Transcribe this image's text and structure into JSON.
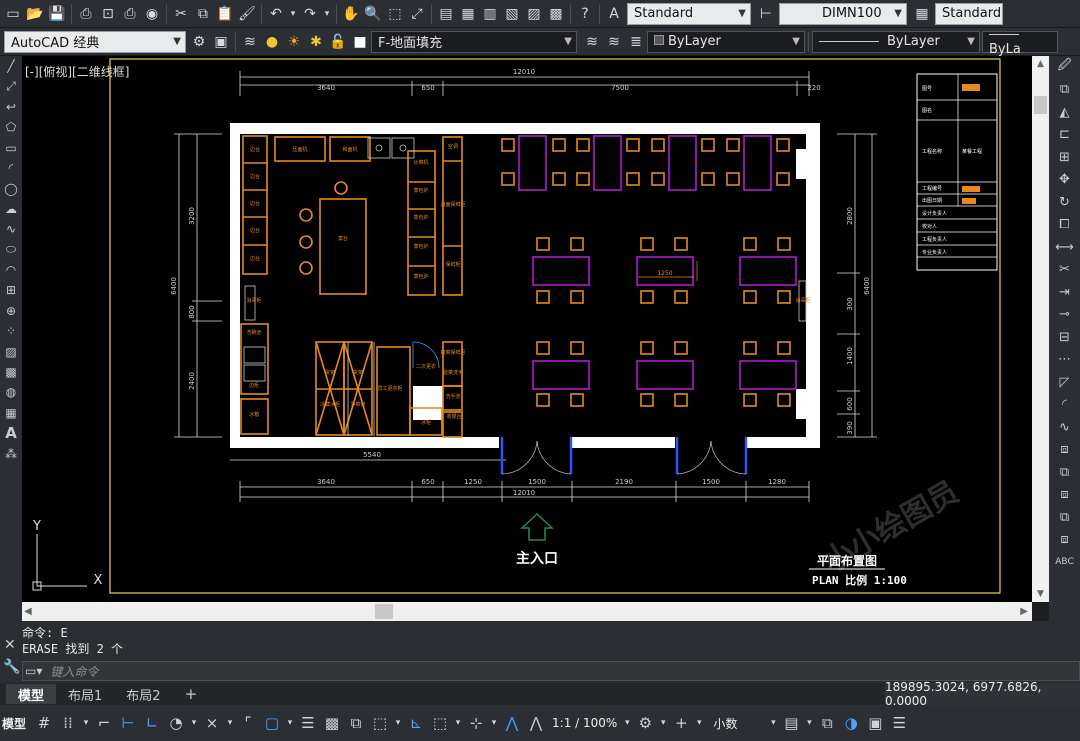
{
  "toolbar1": {
    "text_style": "Standard",
    "dim_style": "DIMN100",
    "table_style": "Standard"
  },
  "toolbar2": {
    "workspace": "AutoCAD 经典",
    "layer": "F-地面填充",
    "color": "ByLayer",
    "linetype": "ByLayer",
    "lineweight": "ByLa"
  },
  "viewport": {
    "label": "[-][俯视][二维线框]",
    "ucs_x": "X",
    "ucs_y": "Y"
  },
  "drawing": {
    "dims_top": [
      "12010",
      "3640",
      "650",
      "7500",
      "220"
    ],
    "dims_bottom": [
      "5540",
      "3640",
      "650",
      "1250",
      "1500",
      "2190",
      "1500",
      "1280",
      "12010"
    ],
    "dims_left": [
      "6400",
      "3200",
      "800",
      "2400"
    ],
    "dims_right": [
      "6400",
      "2800",
      "300",
      "1400",
      "600",
      "390"
    ],
    "table_dim": "1250",
    "kitchen_labels": [
      "边台",
      "边台",
      "边台",
      "边台",
      "边台",
      "压面机",
      "和面机",
      "炒菜机",
      "空调",
      "蒸包炉",
      "蒸包炉",
      "蒸包炉",
      "蒸包炉",
      "温面保鲜柜",
      "保鲜柜",
      "案台",
      "消毒柜",
      "消毒柜",
      "洗碗池",
      "收银台",
      "冰箱",
      "蔬菜保鲜柜",
      "二次更衣",
      "洗手池",
      "冰柜",
      "货架",
      "货架",
      "冷藏冰柜",
      "员工更衣柜",
      "验菜洗手",
      "净菜架",
      "边柜"
    ],
    "entrance": "主入口",
    "title_main": "平面布置图",
    "title_sub": "PLAN  比例 1:100",
    "watermark": "小小绘图员",
    "title_block": [
      "图号",
      "图名",
      "工程名称",
      "某餐工程",
      "工程编号",
      "出图日期",
      "设计负责人",
      "校对人",
      "工程负责人",
      "专业负责人"
    ]
  },
  "command": {
    "line1": "命令: E",
    "line2": "ERASE 找到 2 个",
    "placeholder": "键入命令"
  },
  "tabs": [
    "模型",
    "布局1",
    "布局2"
  ],
  "coordinates": "189895.3024, 6977.6826, 0.0000",
  "status": {
    "model": "模型",
    "scale": "1:1 / 100%",
    "units": "小数"
  }
}
